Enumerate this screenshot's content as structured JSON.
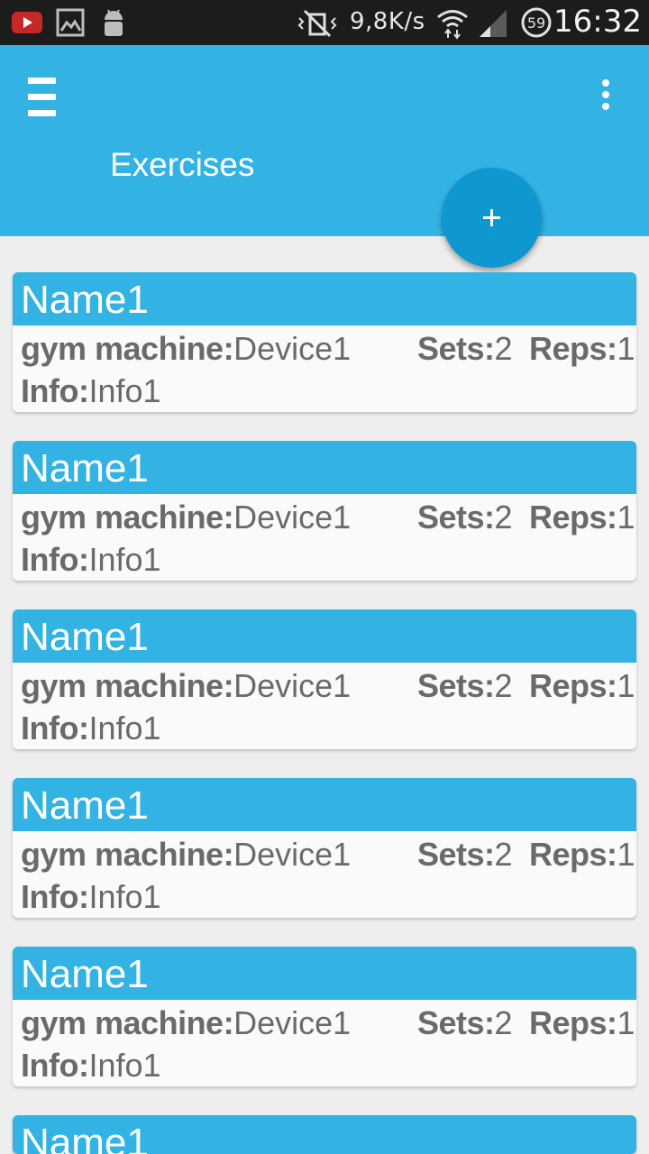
{
  "status_bar": {
    "net_speed": "9,8K/s",
    "battery_level": "59",
    "clock": "16:32",
    "left_icons": [
      "youtube-icon",
      "gallery-icon",
      "android-debug-icon"
    ],
    "right_icons": [
      "vibrate-mute-icon",
      "wifi-icon",
      "signal-icon",
      "battery-icon"
    ]
  },
  "app_bar": {
    "title": "Exercises",
    "color": "#33b3e4",
    "fab_color": "#0f98d0"
  },
  "fab": {
    "label": "+"
  },
  "labels": {
    "gym_machine": "gym machine:",
    "sets": "Sets:",
    "reps": "Reps:",
    "info": "Info:"
  },
  "cards": [
    {
      "name": "Name1",
      "device": "Device1",
      "sets": "2",
      "reps": "1",
      "info": "Info1"
    },
    {
      "name": "Name1",
      "device": "Device1",
      "sets": "2",
      "reps": "1",
      "info": "Info1"
    },
    {
      "name": "Name1",
      "device": "Device1",
      "sets": "2",
      "reps": "1",
      "info": "Info1"
    },
    {
      "name": "Name1",
      "device": "Device1",
      "sets": "2",
      "reps": "1",
      "info": "Info1"
    },
    {
      "name": "Name1",
      "device": "Device1",
      "sets": "2",
      "reps": "1",
      "info": "Info1"
    },
    {
      "name": "Name1"
    }
  ]
}
